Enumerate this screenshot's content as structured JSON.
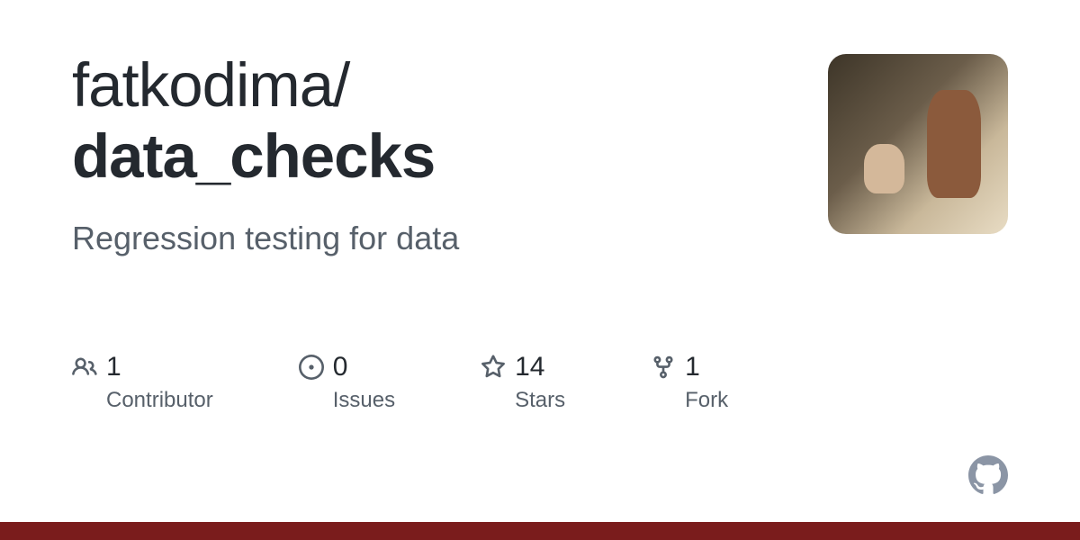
{
  "repo": {
    "owner": "fatkodima",
    "separator": "/",
    "name": "data_checks",
    "description": "Regression testing for data"
  },
  "stats": {
    "contributors": {
      "count": "1",
      "label": "Contributor"
    },
    "issues": {
      "count": "0",
      "label": "Issues"
    },
    "stars": {
      "count": "14",
      "label": "Stars"
    },
    "forks": {
      "count": "1",
      "label": "Fork"
    }
  }
}
